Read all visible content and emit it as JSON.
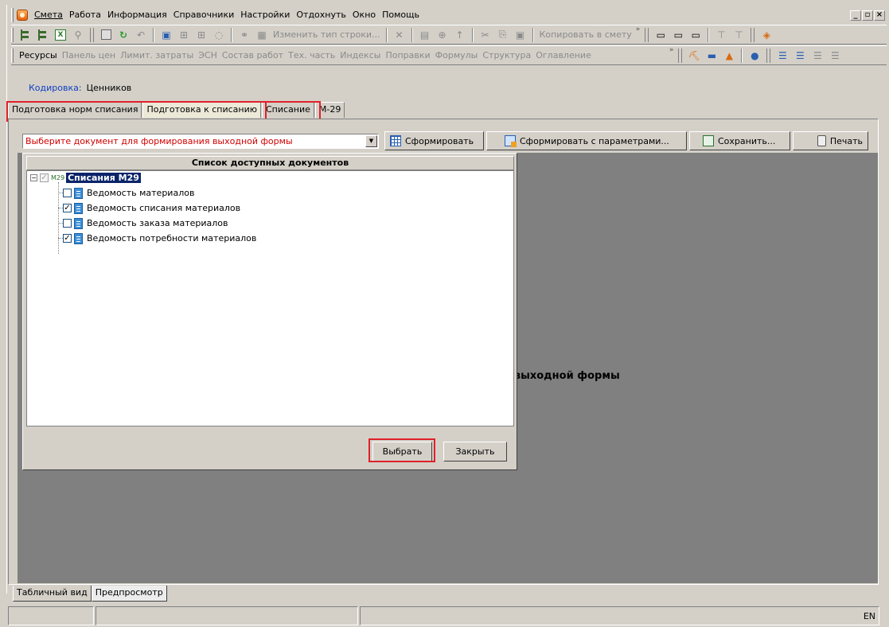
{
  "menu": {
    "items": [
      "Смета",
      "Работа",
      "Информация",
      "Справочники",
      "Настройки",
      "Отдохнуть",
      "Окно",
      "Помощь"
    ],
    "window_controls": [
      "_",
      "▫",
      "×"
    ]
  },
  "toolbar1": {
    "change_row_type": "Изменить тип строки...",
    "copy_to_estimate": "Копировать в смету"
  },
  "toolbar2": {
    "items": [
      "Ресурсы",
      "Панель цен",
      "Лимит. затраты",
      "ЭСН",
      "Состав работ",
      "Тех. часть",
      "Индексы",
      "Поправки",
      "Формулы",
      "Структура",
      "Оглавление"
    ]
  },
  "coding": {
    "label": "Кодировка:",
    "value": "Ценников"
  },
  "tabs": [
    "Подготовка норм списания",
    "Подготовка к списанию",
    "Списание",
    "М-29"
  ],
  "combo": {
    "placeholder": "Выберите документ для формирования выходной формы"
  },
  "buttons": {
    "form": "Сформировать",
    "form_params": "Сформировать с параметрами...",
    "save": "Сохранить...",
    "print": "Печать"
  },
  "background_message": "я выходной формы",
  "dialog": {
    "header": "Список доступных документов",
    "root": {
      "prefix": "M29",
      "label": "Списания М29"
    },
    "items": [
      {
        "label": "Ведомость материалов",
        "checked": false
      },
      {
        "label": "Ведомость списания материалов",
        "checked": true
      },
      {
        "label": "Ведомость заказа материалов",
        "checked": false
      },
      {
        "label": "Ведомость потребности материалов",
        "checked": true
      }
    ],
    "select_button": "Выбрать",
    "close_button": "Закрыть"
  },
  "bottom_tabs": [
    "Табличный вид",
    "Предпросмотр"
  ],
  "status": {
    "lang": "EN"
  },
  "colors": {
    "highlight": "#e0202a",
    "selection": "#0a246a",
    "combo_text": "#d00000"
  },
  "icons": [
    "app-icon",
    "tree-icon",
    "excel-icon",
    "search-icon",
    "save-icon",
    "refresh-icon",
    "undo-icon",
    "print-icon",
    "document-icon",
    "grid-icon"
  ]
}
